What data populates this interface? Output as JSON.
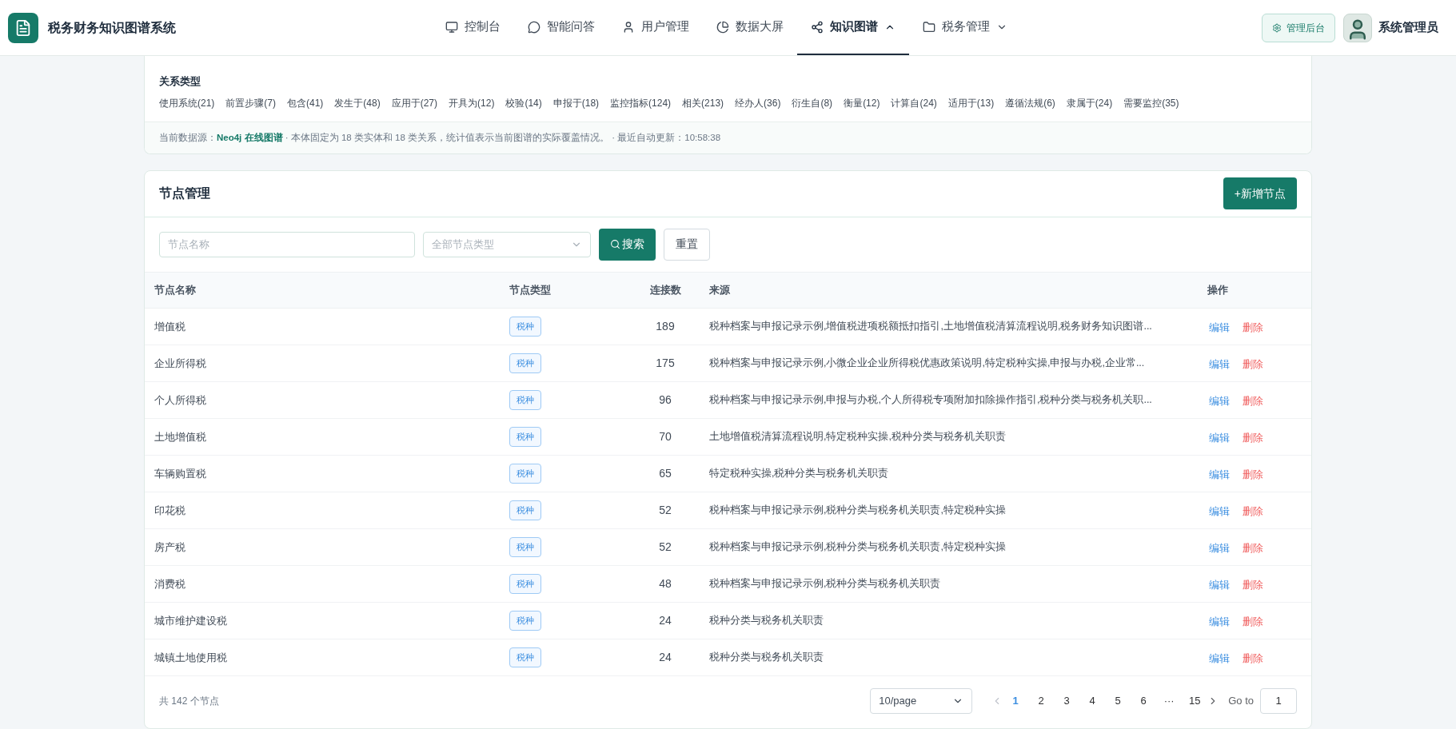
{
  "app": {
    "title": "税务财务知识图谱系统"
  },
  "nav": [
    {
      "label": "控制台",
      "selected": false,
      "dropdown": false
    },
    {
      "label": "智能问答",
      "selected": false,
      "dropdown": false
    },
    {
      "label": "用户管理",
      "selected": false,
      "dropdown": false
    },
    {
      "label": "数据大屏",
      "selected": false,
      "dropdown": false
    },
    {
      "label": "知识图谱",
      "selected": true,
      "dropdown": true
    },
    {
      "label": "税务管理",
      "selected": false,
      "dropdown": true
    }
  ],
  "admin_button": "管理后台",
  "user": {
    "name": "系统管理员"
  },
  "relations": {
    "title": "关系类型",
    "items": [
      "使用系统(21)",
      "前置步骤(7)",
      "包含(41)",
      "发生于(48)",
      "应用于(27)",
      "开具为(12)",
      "校验(14)",
      "申报于(18)",
      "监控指标(124)",
      "相关(213)",
      "经办人(36)",
      "衍生自(8)",
      "衡量(12)",
      "计算自(24)",
      "适用于(13)",
      "遵循法规(6)",
      "隶属于(24)",
      "需要监控(35)"
    ]
  },
  "source_note": {
    "label": "当前数据源：",
    "source": "Neo4j 在线图谱",
    "text": "· 本体固定为 18 类实体和 18 类关系，统计值表示当前图谱的实际覆盖情况。 · 最近自动更新：10:58:38"
  },
  "nodes": {
    "title": "节点管理",
    "add_button": "+新增节点",
    "search": {
      "placeholder": "节点名称"
    },
    "type_select": {
      "placeholder": "全部节点类型"
    },
    "search_button": "搜索",
    "reset_button": "重置",
    "columns": [
      "节点名称",
      "节点类型",
      "连接数",
      "来源",
      "操作"
    ],
    "rows": [
      {
        "name": "增值税",
        "type": "税种",
        "links": "189",
        "source": "税种档案与申报记录示例,增值税进项税额抵扣指引,土地增值税清算流程说明,税务财务知识图谱..."
      },
      {
        "name": "企业所得税",
        "type": "税种",
        "links": "175",
        "source": "税种档案与申报记录示例,小微企业企业所得税优惠政策说明,特定税种实操,申报与办税,企业常..."
      },
      {
        "name": "个人所得税",
        "type": "税种",
        "links": "96",
        "source": "税种档案与申报记录示例,申报与办税,个人所得税专项附加扣除操作指引,税种分类与税务机关职..."
      },
      {
        "name": "土地增值税",
        "type": "税种",
        "links": "70",
        "source": "土地增值税清算流程说明,特定税种实操,税种分类与税务机关职责"
      },
      {
        "name": "车辆购置税",
        "type": "税种",
        "links": "65",
        "source": "特定税种实操,税种分类与税务机关职责"
      },
      {
        "name": "印花税",
        "type": "税种",
        "links": "52",
        "source": "税种档案与申报记录示例,税种分类与税务机关职责,特定税种实操"
      },
      {
        "name": "房产税",
        "type": "税种",
        "links": "52",
        "source": "税种档案与申报记录示例,税种分类与税务机关职责,特定税种实操"
      },
      {
        "name": "消费税",
        "type": "税种",
        "links": "48",
        "source": "税种档案与申报记录示例,税种分类与税务机关职责"
      },
      {
        "name": "城市维护建设税",
        "type": "税种",
        "links": "24",
        "source": "税种分类与税务机关职责"
      },
      {
        "name": "城镇土地使用税",
        "type": "税种",
        "links": "24",
        "source": "税种分类与税务机关职责"
      }
    ],
    "row_actions": [
      {
        "edit": "编辑",
        "delete": "删除"
      },
      {
        "edit": "编辑",
        "delete": "删除"
      },
      {
        "edit": "编辑",
        "delete": "删除"
      },
      {
        "edit": "编辑",
        "delete": "删除"
      },
      {
        "edit": "编辑",
        "delete": "删除"
      },
      {
        "edit": "编辑",
        "delete": "删除"
      },
      {
        "edit": "编辑",
        "delete": "删除"
      },
      {
        "edit": "编辑",
        "delete": "删除"
      },
      {
        "edit": "编辑",
        "delete": "删除"
      },
      {
        "edit": "编辑",
        "delete": "删除"
      }
    ],
    "total": "共 142 个节点",
    "page_size": "10/page",
    "pages": [
      {
        "label": "1",
        "selected": true
      },
      {
        "label": "2",
        "selected": false
      },
      {
        "label": "3",
        "selected": false
      },
      {
        "label": "4",
        "selected": false
      },
      {
        "label": "5",
        "selected": false
      },
      {
        "label": "6",
        "selected": false
      },
      {
        "label": "···",
        "selected": false
      },
      {
        "label": "15",
        "selected": false
      }
    ],
    "goto": {
      "label": "Go to",
      "value": "1"
    }
  }
}
